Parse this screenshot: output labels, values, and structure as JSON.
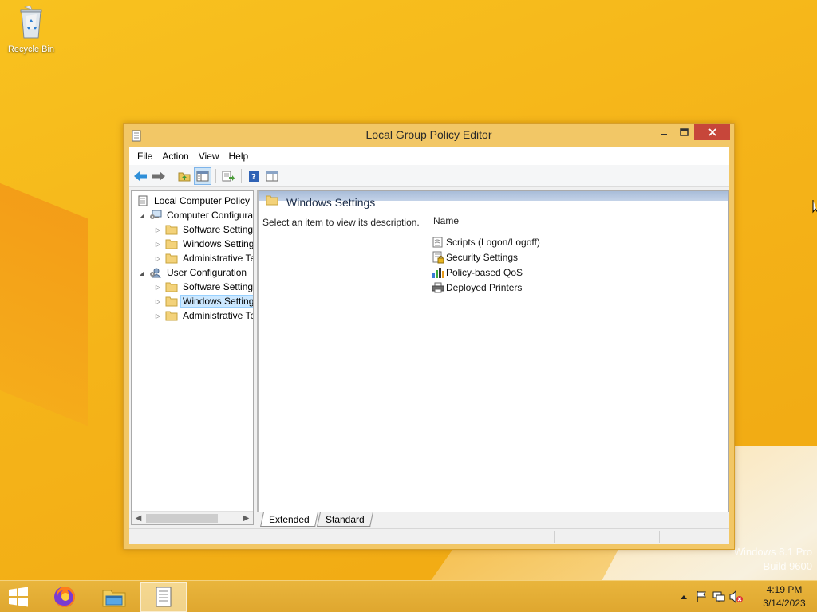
{
  "desktop": {
    "icons": [
      {
        "label": "Recycle Bin",
        "icon": "recycle-bin-icon"
      }
    ],
    "watermark": {
      "line1": "Windows 8.1 Pro",
      "line2": "Build 9600"
    }
  },
  "window": {
    "title": "Local Group Policy Editor",
    "controls": {
      "minimize": "–",
      "maximize": "□",
      "close": "✕"
    },
    "menu": [
      "File",
      "Action",
      "View",
      "Help"
    ],
    "toolbar": [
      "back-icon",
      "forward-icon",
      "up-folder-icon",
      "show-hide-tree-icon",
      "export-list-icon",
      "help-icon",
      "properties-icon"
    ]
  },
  "tree": {
    "root": "Local Computer Policy",
    "nodes": [
      {
        "label": "Computer Configura",
        "expanded": true,
        "icon": "computer-config-icon"
      },
      {
        "label": "Software Settings",
        "icon": "folder-icon"
      },
      {
        "label": "Windows Setting",
        "icon": "folder-icon"
      },
      {
        "label": "Administrative Te",
        "icon": "folder-icon"
      },
      {
        "label": "User Configuration",
        "expanded": true,
        "icon": "user-config-icon"
      },
      {
        "label": "Software Settings",
        "icon": "folder-icon"
      },
      {
        "label": "Windows Setting",
        "icon": "folder-icon",
        "selected": true
      },
      {
        "label": "Administrative Te",
        "icon": "folder-icon"
      }
    ]
  },
  "details": {
    "header_title": "Windows Settings",
    "description": "Select an item to view its description.",
    "column": "Name",
    "items": [
      {
        "label": "Scripts (Logon/Logoff)",
        "icon": "scripts-icon"
      },
      {
        "label": "Security Settings",
        "icon": "security-settings-icon"
      },
      {
        "label": "Policy-based QoS",
        "icon": "qos-chart-icon"
      },
      {
        "label": "Deployed Printers",
        "icon": "printer-icon"
      }
    ]
  },
  "tabs": [
    {
      "label": "Extended",
      "active": true
    },
    {
      "label": "Standard",
      "active": false
    }
  ],
  "taskbar": {
    "apps": [
      "firefox-icon",
      "file-explorer-icon",
      "group-policy-editor-icon"
    ],
    "tray_icons": [
      "show-hidden-icons-icon",
      "action-center-flag-icon",
      "network-icon",
      "volume-muted-icon"
    ],
    "time": "4:19 PM",
    "date": "3/14/2023"
  },
  "colors": {
    "desktop": "#f5b419",
    "window_frame": "#f2c766",
    "close_button": "#c7463a",
    "selection": "#cce8ff"
  }
}
